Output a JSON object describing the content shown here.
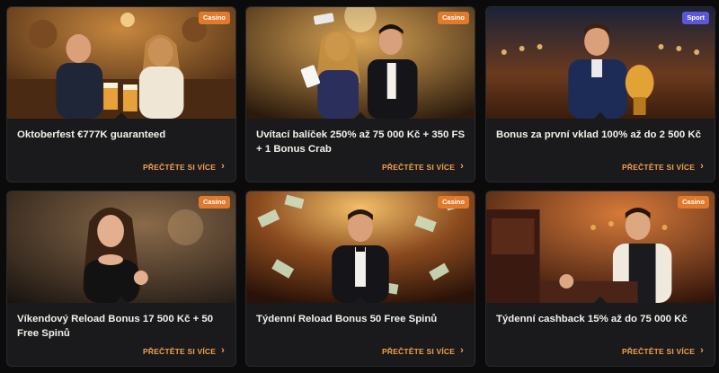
{
  "theme": {
    "accent": "#f2a24d",
    "casino_badge": "#e07b2e",
    "sport_badge": "#5c57d8",
    "card_bg": "#1a1a1c"
  },
  "promos": [
    {
      "badge": "Casino",
      "title": "Oktoberfest €777K guaranteed",
      "cta": "PŘEČTĚTE SI VÍCE"
    },
    {
      "badge": "Casino",
      "title": "Uvítací balíček 250% až 75 000 Kč + 350 FS + 1 Bonus Crab",
      "cta": "PŘEČTĚTE SI VÍCE"
    },
    {
      "badge": "Sport",
      "title": "Bonus za první vklad 100% až do 2 500 Kč",
      "cta": "PŘEČTĚTE SI VÍCE"
    },
    {
      "badge": "Casino",
      "title": "Víkendový Reload Bonus 17 500 Kč + 50 Free Spinů",
      "cta": "PŘEČTĚTE SI VÍCE"
    },
    {
      "badge": "Casino",
      "title": "Týdenní Reload Bonus 50 Free Spinů",
      "cta": "PŘEČTĚTE SI VÍCE"
    },
    {
      "badge": "Casino",
      "title": "Týdenní cashback 15% až do 75 000 Kč",
      "cta": "PŘEČTĚTE SI VÍCE"
    }
  ]
}
